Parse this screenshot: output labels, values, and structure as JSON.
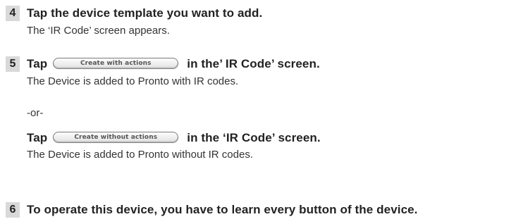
{
  "steps": [
    {
      "number": "4",
      "text": "Tap the device template you want to add.",
      "result": "The ‘IR Code’ screen appears."
    },
    {
      "number": "5",
      "before": "Tap",
      "button": "Create with actions",
      "after": "in the’ IR Code’ screen.",
      "result": "The Device is added to Pronto with IR codes."
    },
    {
      "number": "6",
      "text": "To operate this device, you have to learn every button of the device."
    }
  ],
  "alternative": {
    "separator": "-or-",
    "before": "Tap",
    "button": "Create without actions",
    "after": "in the ‘IR Code’ screen.",
    "result": "The Device is added to Pronto without IR codes."
  }
}
